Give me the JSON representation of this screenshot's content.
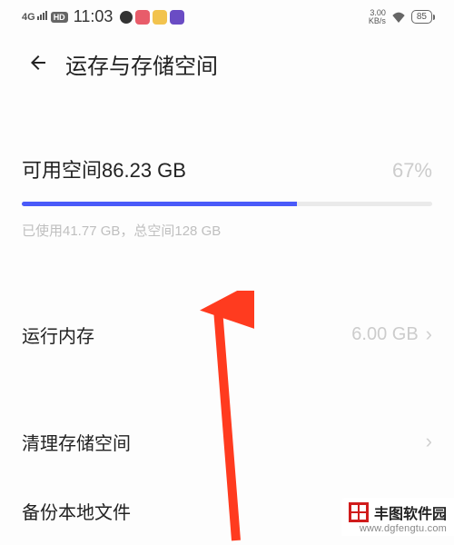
{
  "statusBar": {
    "signal": "4G",
    "hd": "HD",
    "time": "11:03",
    "netspeedTop": "3.00",
    "netspeedBottom": "KB/s",
    "battery": "85"
  },
  "header": {
    "title": "运存与存储空间"
  },
  "storage": {
    "availableLabel": "可用空间86.23 GB",
    "percent": "67%",
    "fillPercent": "67",
    "detail": "已使用41.77 GB，总空间128 GB"
  },
  "rows": {
    "ram": {
      "label": "运行内存",
      "value": "6.00 GB"
    },
    "clean": {
      "label": "清理存储空间"
    },
    "backup": {
      "label": "备份本地文件"
    }
  },
  "watermark": {
    "name": "丰图软件园",
    "url": "www.dgfengtu.com"
  },
  "colors": {
    "progressFill": "#4a5af9",
    "arrow": "#ff3b1f"
  }
}
